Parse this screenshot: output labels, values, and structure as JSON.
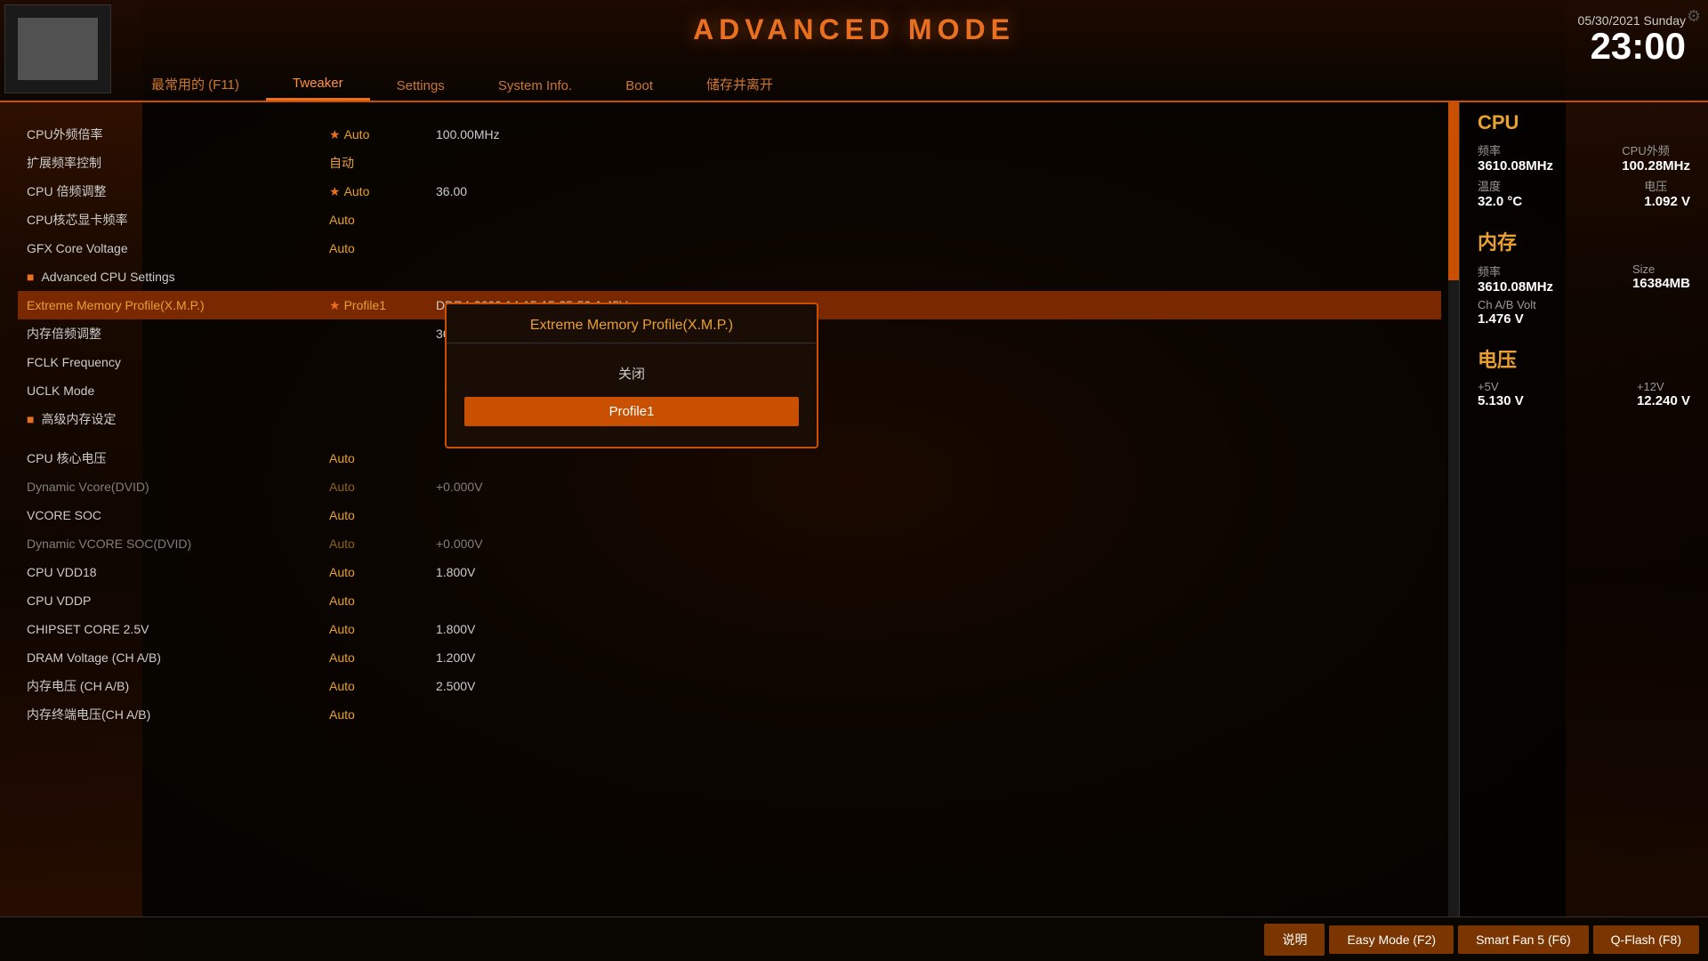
{
  "header": {
    "title": "ADVANCED MODE",
    "date": "05/30/2021",
    "day": "Sunday",
    "time": "23:00"
  },
  "nav": {
    "tabs": [
      {
        "label": "最常用的 (F11)",
        "active": false
      },
      {
        "label": "Tweaker",
        "active": true
      },
      {
        "label": "Settings",
        "active": false
      },
      {
        "label": "System Info.",
        "active": false
      },
      {
        "label": "Boot",
        "active": false
      },
      {
        "label": "储存并离开",
        "active": false
      }
    ]
  },
  "settings": {
    "rows": [
      {
        "label": "CPU外频倍率",
        "value": "Auto",
        "star": true,
        "extra": "100.00MHz"
      },
      {
        "label": "扩展频率控制",
        "value": "自动",
        "star": false,
        "extra": ""
      },
      {
        "label": "CPU 倍频调整",
        "value": "Auto",
        "star": true,
        "extra": "36.00"
      },
      {
        "label": "CPU核芯显卡频率",
        "value": "Auto",
        "star": false,
        "extra": ""
      },
      {
        "label": "GFX Core Voltage",
        "value": "Auto",
        "star": false,
        "extra": ""
      },
      {
        "label": "Advanced CPU Settings",
        "value": "",
        "star": false,
        "extra": "",
        "bullet": true
      },
      {
        "label": "Extreme Memory Profile(X.M.P.)",
        "value": "Profile1",
        "star": true,
        "extra": "DDR4-3600 14-15-15-35-50-1.45V",
        "highlighted": true
      },
      {
        "label": "内存倍频调整",
        "value": "",
        "star": false,
        "extra": "36.00"
      },
      {
        "label": "FCLK Frequency",
        "value": "",
        "star": false,
        "extra": ""
      },
      {
        "label": "UCLK Mode",
        "value": "",
        "star": false,
        "extra": ""
      },
      {
        "label": "高级内存设定",
        "value": "",
        "star": false,
        "extra": "",
        "bullet": true
      },
      {
        "label": "CPU 核心电压",
        "value": "Auto",
        "star": false,
        "extra": ""
      },
      {
        "label": "Dynamic Vcore(DVID)",
        "value": "Auto",
        "star": false,
        "extra": "+0.000V",
        "dim": true
      },
      {
        "label": "VCORE SOC",
        "value": "Auto",
        "star": false,
        "extra": ""
      },
      {
        "label": "Dynamic VCORE SOC(DVID)",
        "value": "Auto",
        "star": false,
        "extra": "+0.000V",
        "dim": true
      },
      {
        "label": "CPU VDD18",
        "value": "Auto",
        "star": false,
        "extra": "1.800V"
      },
      {
        "label": "CPU VDDP",
        "value": "Auto",
        "star": false,
        "extra": ""
      },
      {
        "label": "CHIPSET CORE 2.5V",
        "value": "Auto",
        "star": false,
        "extra": "1.800V"
      },
      {
        "label": "DRAM Voltage    (CH A/B)",
        "value": "Auto",
        "star": false,
        "extra": "1.200V"
      },
      {
        "label": "内存电压      (CH A/B)",
        "value": "Auto",
        "star": false,
        "extra": "2.500V"
      },
      {
        "label": "内存终端电压(CH A/B)",
        "value": "Auto",
        "star": false,
        "extra": ""
      }
    ]
  },
  "popup": {
    "title": "Extreme Memory Profile(X.M.P.)",
    "options": [
      {
        "label": "关闭",
        "selected": false
      },
      {
        "label": "Profile1",
        "selected": true
      }
    ]
  },
  "info_panel": {
    "cpu": {
      "title": "CPU",
      "freq_label": "频率",
      "freq_value": "3610.08MHz",
      "ext_freq_label": "CPU外频",
      "ext_freq_value": "100.28MHz",
      "temp_label": "温度",
      "temp_value": "32.0 °C",
      "volt_label": "电压",
      "volt_value": "1.092 V"
    },
    "memory": {
      "title": "内存",
      "freq_label": "频率",
      "freq_value": "3610.08MHz",
      "size_label": "Size",
      "size_value": "16384MB",
      "volt_label": "Ch A/B Volt",
      "volt_value": "1.476 V"
    },
    "voltage": {
      "title": "电压",
      "v5_label": "+5V",
      "v5_value": "5.130 V",
      "v12_label": "+12V",
      "v12_value": "12.240 V"
    }
  },
  "toolbar": {
    "buttons": [
      {
        "label": "说明",
        "key": ""
      },
      {
        "label": "Easy Mode (F2)",
        "key": "F2"
      },
      {
        "label": "Smart Fan 5 (F6)",
        "key": "F6"
      },
      {
        "label": "Q-Flash (F8)",
        "key": "F8"
      }
    ]
  }
}
